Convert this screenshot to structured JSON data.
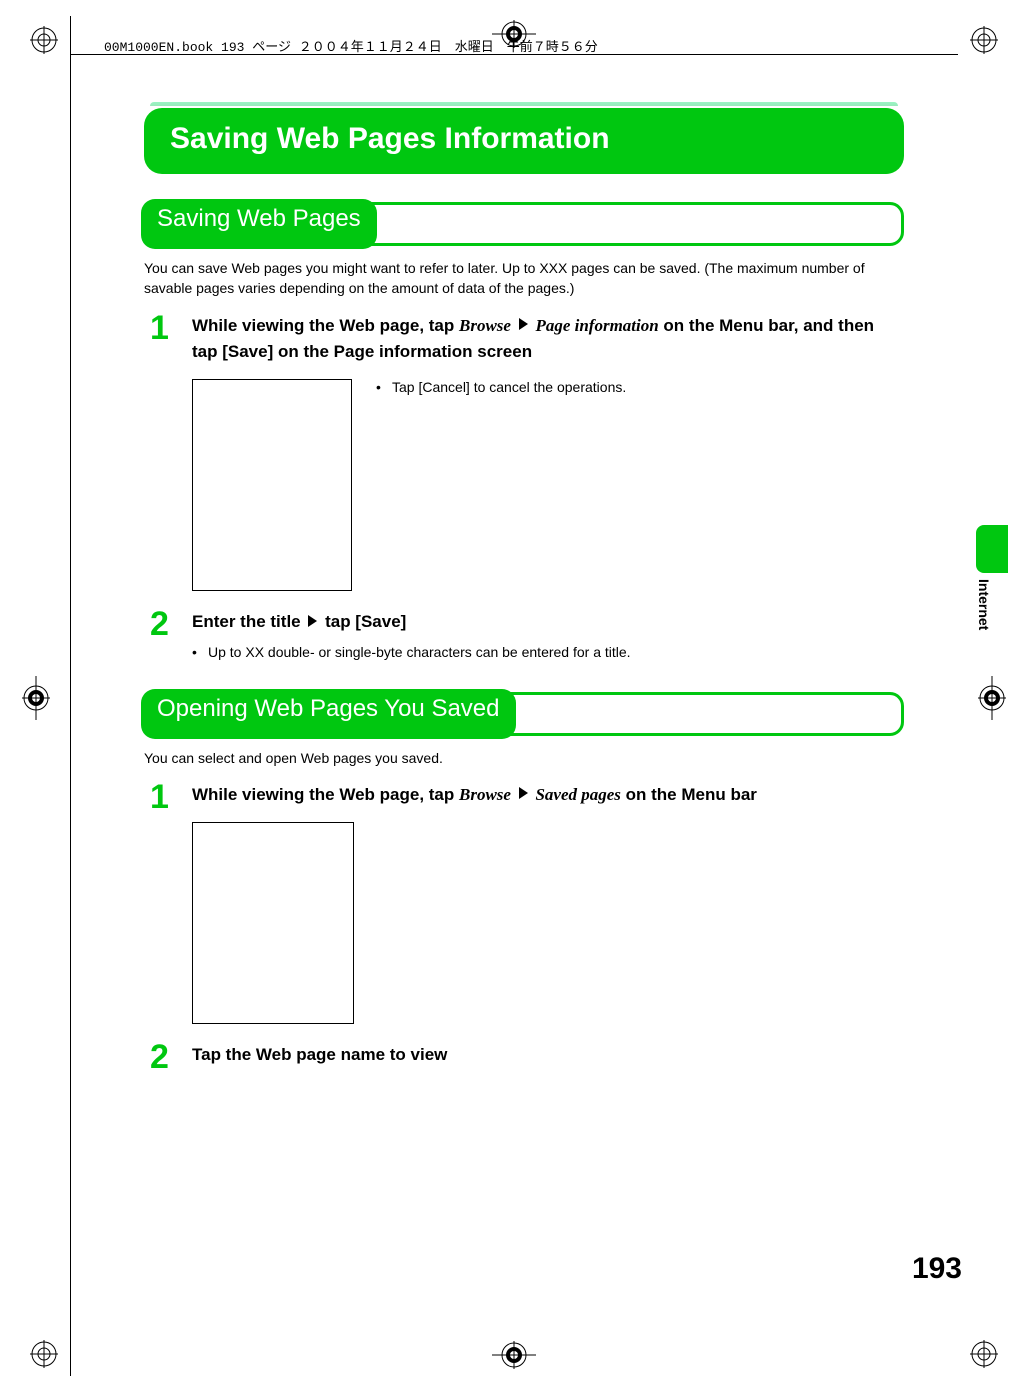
{
  "header_line": "00M1000EN.book  193 ページ  ２００４年１１月２４日　水曜日　午前７時５６分",
  "title": "Saving Web Pages Information",
  "tab_label": "Internet",
  "page_number": "193",
  "section1": {
    "heading": "Saving Web Pages",
    "intro": "You can save Web pages you might want to refer to later. Up to XXX pages can be saved. (The maximum number of savable pages varies depending on the amount of data of the pages.)",
    "step1": {
      "num": "1",
      "head_a": "While viewing the Web page, tap ",
      "head_b_ital": "Browse",
      "head_c_ital": "Page information",
      "head_d": " on the Menu bar, and then tap [Save] on the Page information screen",
      "bullet": "Tap [Cancel] to cancel the operations."
    },
    "step2": {
      "num": "2",
      "head_a": "Enter the title ",
      "head_b": " tap [Save]",
      "bullet": "Up to XX double- or single-byte characters can be entered for a title."
    }
  },
  "section2": {
    "heading": "Opening Web Pages You Saved",
    "intro": "You can select and open Web pages you saved.",
    "step1": {
      "num": "1",
      "head_a": "While viewing the Web page, tap ",
      "head_b_ital": "Browse",
      "head_c_ital": "Saved pages",
      "head_d": " on the Menu bar"
    },
    "step2": {
      "num": "2",
      "head": "Tap the Web page name to view"
    }
  }
}
